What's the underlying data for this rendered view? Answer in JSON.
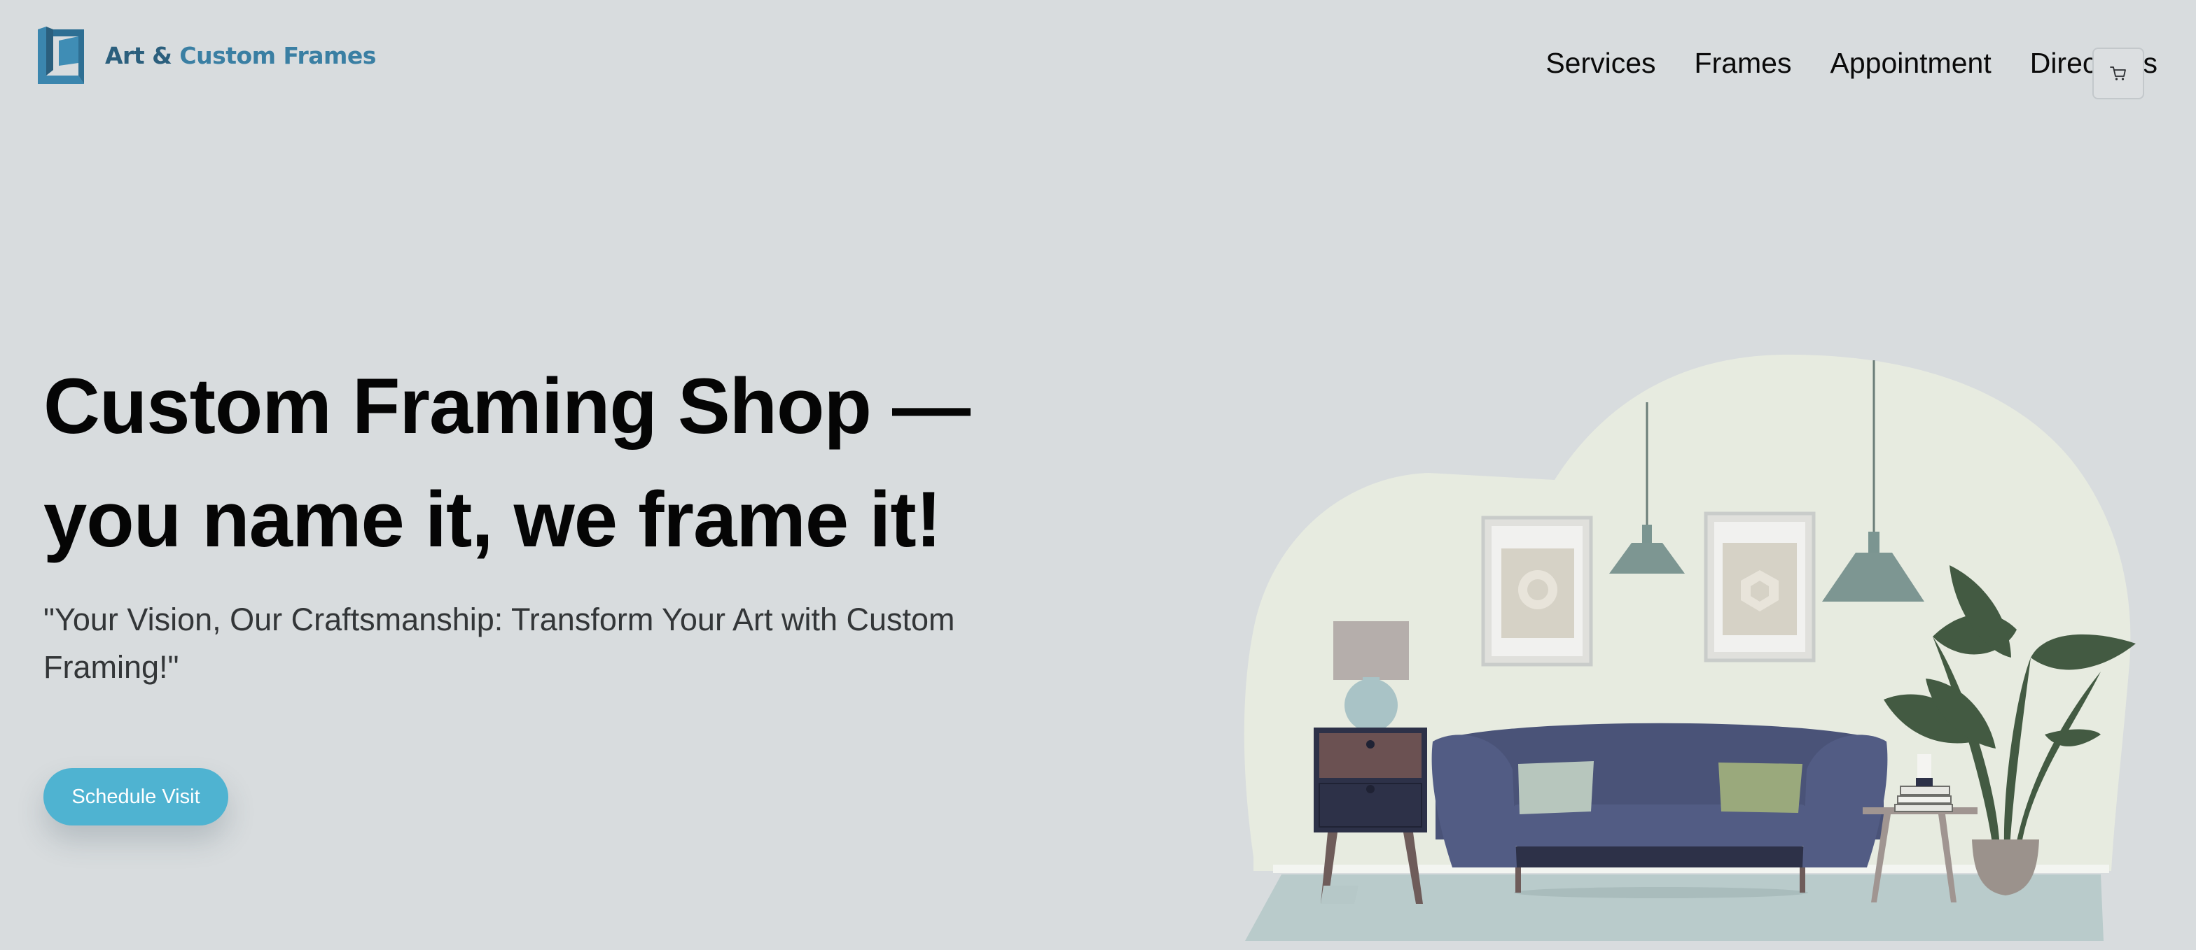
{
  "header": {
    "logo": {
      "brand_part1": "Art &",
      "brand_part2": "Custom Frames",
      "icon": "frame-logo-icon"
    },
    "nav": [
      {
        "label": "Services"
      },
      {
        "label": "Frames"
      },
      {
        "label": "Appointment"
      },
      {
        "label": "Directions"
      }
    ],
    "cart": {
      "icon": "cart-icon"
    }
  },
  "hero": {
    "title_line1": "Custom Framing Shop —",
    "title_line2": "you name it, we frame it!",
    "subtitle": "\"Your Vision, Our Craftsmanship: Transform Your Art with Custom Framing!\"",
    "cta_label": "Schedule Visit"
  },
  "colors": {
    "page_background": "#d8dcde",
    "accent": "#4fb3d1",
    "logo_dark": "#2b5f7d",
    "logo_light": "#3a7fa3",
    "blob": "#e7ebe0",
    "sofa": "#4a5378"
  },
  "illustration": {
    "icon": "living-room-illustration"
  }
}
